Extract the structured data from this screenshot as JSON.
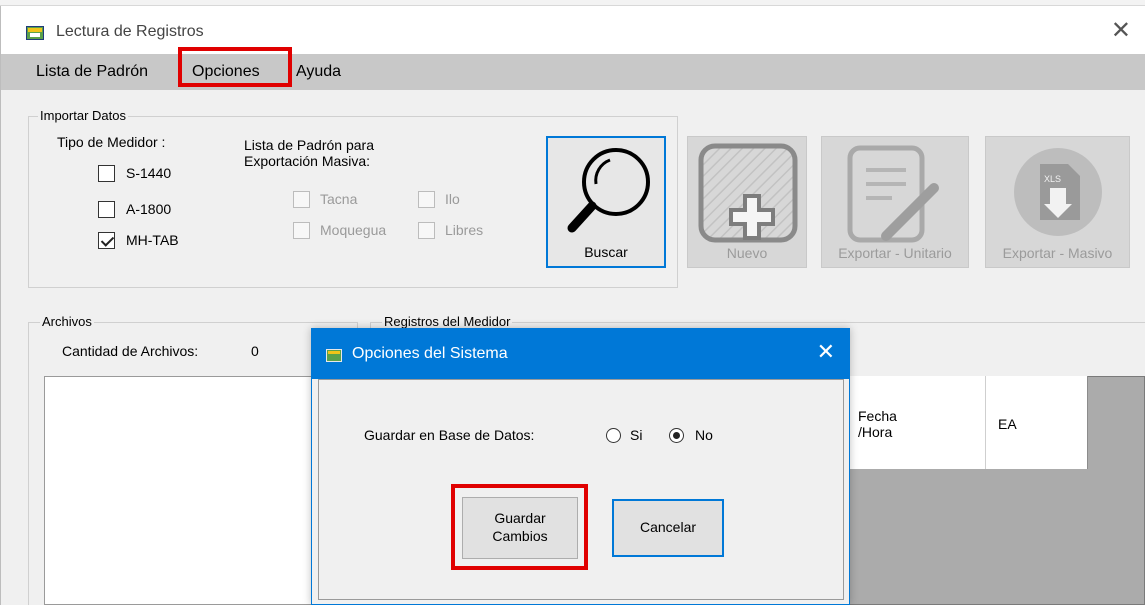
{
  "window": {
    "title": "Lectura de Registros",
    "close_glyph": "✕"
  },
  "menu": {
    "items": [
      "Lista de Padrón",
      "Opciones",
      "Ayuda"
    ]
  },
  "import_group": {
    "label": "Importar Datos",
    "meter_type_label": "Tipo de Medidor :",
    "meters": [
      {
        "label": "S-1440",
        "checked": false
      },
      {
        "label": "A-1800",
        "checked": false
      },
      {
        "label": "MH-TAB",
        "checked": true
      }
    ],
    "padron_label_line1": "Lista de Padrón para",
    "padron_label_line2": "Exportación Masiva:",
    "padron_options": [
      {
        "label": "Tacna",
        "enabled": false
      },
      {
        "label": "Ilo",
        "enabled": false
      },
      {
        "label": "Moquegua",
        "enabled": false
      },
      {
        "label": "Libres",
        "enabled": false
      }
    ]
  },
  "toolbar": {
    "buscar": "Buscar",
    "nuevo": "Nuevo",
    "exportar_unitario": "Exportar - Unitario",
    "exportar_masivo": "Exportar - Masivo",
    "xls_badge": "XLS"
  },
  "archivos": {
    "label": "Archivos",
    "count_label": "Cantidad de Archivos:",
    "count_value": "0"
  },
  "registros": {
    "label": "Registros del Medidor",
    "columns": [
      "Fecha\n/Hora",
      "EA"
    ]
  },
  "dialog": {
    "title": "Opciones del Sistema",
    "close_glyph": "✕",
    "db_label": "Guardar en Base de Datos:",
    "options": [
      {
        "label": "Si",
        "selected": false
      },
      {
        "label": "No",
        "selected": true
      }
    ],
    "save_label_line1": "Guardar",
    "save_label_line2": "Cambios",
    "cancel_label": "Cancelar"
  },
  "colors": {
    "accent": "#0078d7",
    "highlight": "#e00000",
    "menubar": "#c8c8c8"
  }
}
